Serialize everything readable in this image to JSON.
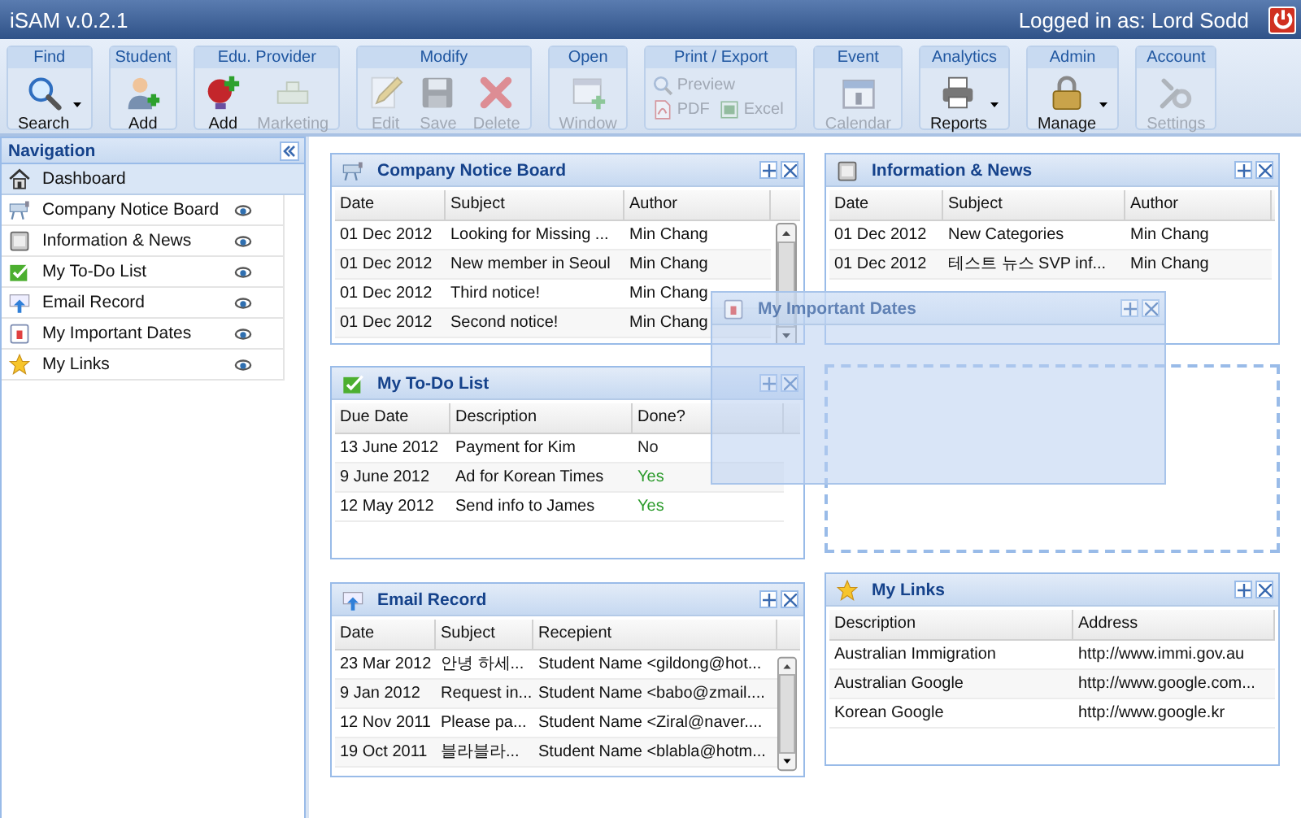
{
  "window": {
    "title": "iSAM v.0.2.1",
    "user_label": "Logged in as: Lord Sodd"
  },
  "toolbar": {
    "groups": [
      {
        "title": "Find",
        "kind": "large",
        "buttons": [
          {
            "label": "Search",
            "kind": "search",
            "disabled": false,
            "dropdown": true
          }
        ]
      },
      {
        "title": "Student",
        "kind": "large",
        "buttons": [
          {
            "label": "Add",
            "kind": "student-add",
            "disabled": false,
            "dropdown": false
          }
        ]
      },
      {
        "title": "Edu. Provider",
        "kind": "large",
        "buttons": [
          {
            "label": "Add",
            "kind": "provider-add",
            "disabled": false,
            "dropdown": false
          },
          {
            "label": "Marketing",
            "kind": "marketing",
            "disabled": true,
            "dropdown": false
          }
        ]
      },
      {
        "title": "Modify",
        "kind": "large",
        "buttons": [
          {
            "label": "Edit",
            "kind": "edit",
            "disabled": true,
            "dropdown": false
          },
          {
            "label": "Save",
            "kind": "save",
            "disabled": true,
            "dropdown": false
          },
          {
            "label": "Delete",
            "kind": "delete",
            "disabled": true,
            "dropdown": false
          }
        ]
      },
      {
        "title": "Open",
        "kind": "large",
        "buttons": [
          {
            "label": "Window",
            "kind": "window",
            "disabled": true,
            "dropdown": false
          }
        ]
      },
      {
        "title": "Print / Export",
        "kind": "compact",
        "buttons": [
          {
            "label": "Preview",
            "kind": "preview",
            "disabled": true,
            "dropdown": false
          },
          {
            "label": "PDF",
            "kind": "pdf",
            "disabled": true,
            "dropdown": false
          },
          {
            "label": "Excel",
            "kind": "excel",
            "disabled": true,
            "dropdown": false
          }
        ]
      },
      {
        "title": "Event",
        "kind": "large",
        "buttons": [
          {
            "label": "Calendar",
            "kind": "calendar",
            "disabled": true,
            "dropdown": false
          }
        ]
      },
      {
        "title": "Analytics",
        "kind": "large",
        "buttons": [
          {
            "label": "Reports",
            "kind": "reports",
            "disabled": false,
            "dropdown": true
          }
        ]
      },
      {
        "title": "Admin",
        "kind": "large",
        "buttons": [
          {
            "label": "Manage",
            "kind": "manage",
            "disabled": false,
            "dropdown": true
          }
        ]
      },
      {
        "title": "Account",
        "kind": "large",
        "buttons": [
          {
            "label": "Settings",
            "kind": "settings",
            "disabled": true,
            "dropdown": false
          }
        ]
      }
    ]
  },
  "navigation": {
    "title": "Navigation",
    "items": [
      {
        "label": "Dashboard",
        "kind": "home",
        "selected": true
      },
      {
        "label": "Company Notice Board",
        "kind": "notice",
        "selected": false
      },
      {
        "label": "Information & News",
        "kind": "news",
        "selected": false
      },
      {
        "label": "My To-Do List",
        "kind": "todo",
        "selected": false
      },
      {
        "label": "Email Record",
        "kind": "email",
        "selected": false
      },
      {
        "label": "My Important Dates",
        "kind": "dates",
        "selected": false
      },
      {
        "label": "My Links",
        "kind": "links",
        "selected": false
      }
    ]
  },
  "columns": [
    {
      "portlets": [
        {
          "kind": "notice",
          "title": "Company Notice Board",
          "table": {
            "columns": [
              "Date",
              "Subject",
              "Author"
            ],
            "rows": [
              {
                "cells": [
                  "01 Dec 2012",
                  "Looking for Missing ...",
                  "Min Chang"
                ]
              },
              {
                "cells": [
                  "01 Dec 2012",
                  "New member in Seoul",
                  "Min Chang"
                ]
              },
              {
                "cells": [
                  "01 Dec 2012",
                  "Third notice!",
                  "Min Chang"
                ]
              },
              {
                "cells": [
                  "01 Dec 2012",
                  "Second notice!",
                  "Min Chang"
                ]
              }
            ]
          }
        },
        {
          "kind": "todo",
          "title": "My To-Do List",
          "table": {
            "columns": [
              "Due Date",
              "Description",
              "Done?"
            ],
            "rows": [
              {
                "cells": [
                  "13 June 2012",
                  "Payment for Kim",
                  "No"
                ],
                "done": false
              },
              {
                "cells": [
                  "9 June 2012",
                  "Ad for Korean Times",
                  "Yes"
                ],
                "done": true
              },
              {
                "cells": [
                  "12 May 2012",
                  "Send info to James",
                  "Yes"
                ],
                "done": true
              }
            ]
          }
        },
        {
          "kind": "email",
          "title": "Email Record",
          "table": {
            "columns": [
              "Date",
              "Subject",
              "Recepient"
            ],
            "rows": [
              {
                "cells": [
                  "23 Mar 2012",
                  "안녕 하세...",
                  "Student Name <gildong@hot..."
                ]
              },
              {
                "cells": [
                  "9 Jan 2012",
                  "Request in...",
                  "Student Name <babo@zmail...."
                ]
              },
              {
                "cells": [
                  "12 Nov 2011",
                  "Please pa...",
                  "Student Name <Ziral@naver...."
                ]
              },
              {
                "cells": [
                  "19 Oct 2011",
                  "블라블라...",
                  "Student Name <blabla@hotm..."
                ]
              }
            ]
          }
        }
      ]
    },
    {
      "portlets": [
        {
          "kind": "news",
          "title": "Information & News",
          "table": {
            "columns": [
              "Date",
              "Subject",
              "Author"
            ],
            "rows": [
              {
                "cells": [
                  "01 Dec 2012",
                  "New Categories",
                  "Min Chang"
                ]
              },
              {
                "cells": [
                  "01 Dec 2012",
                  "테스트 뉴스 SVP inf...",
                  "Min Chang"
                ]
              }
            ]
          }
        },
        {
          "kind": "placeholder"
        },
        {
          "kind": "links",
          "title": "My Links",
          "table": {
            "columns": [
              "Description",
              "Address"
            ],
            "rows": [
              {
                "cells": [
                  "Australian Immigration",
                  "http://www.immi.gov.au"
                ]
              },
              {
                "cells": [
                  "Australian Google",
                  "http://www.google.com..."
                ]
              },
              {
                "cells": [
                  "Korean Google",
                  "http://www.google.kr"
                ]
              }
            ]
          }
        }
      ]
    }
  ],
  "dragged_panel": {
    "kind": "dates",
    "title": "My Important Dates"
  }
}
